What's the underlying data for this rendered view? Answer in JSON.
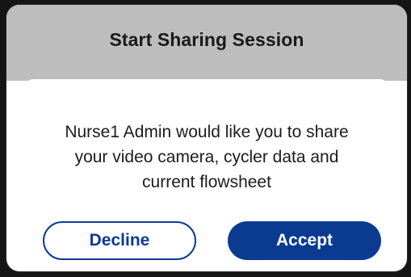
{
  "dialog": {
    "title": "Start Sharing Session",
    "message_lines": [
      "Nurse1 Admin would like you to share",
      "your video camera, cycler data and",
      "current flowsheet"
    ],
    "decline_label": "Decline",
    "accept_label": "Accept"
  },
  "colors": {
    "header_bg": "#bdbdbd",
    "primary": "#0b3b91",
    "card_bg": "#ffffff"
  }
}
